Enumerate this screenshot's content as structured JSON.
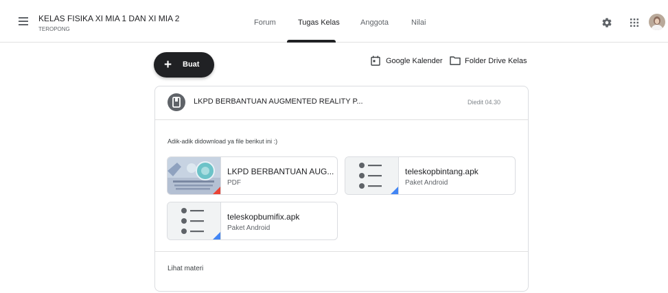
{
  "header": {
    "menu_icon": "hamburger-menu-icon",
    "class_title": "KELAS FISIKA XI MIA 1 DAN XI MIA 2",
    "class_subtitle": "TEROPONG",
    "tabs": [
      {
        "label": "Forum",
        "active": false
      },
      {
        "label": "Tugas Kelas",
        "active": true
      },
      {
        "label": "Anggota",
        "active": false
      },
      {
        "label": "Nilai",
        "active": false
      }
    ],
    "settings_icon": "gear-icon",
    "apps_icon": "apps-grid-icon",
    "avatar_icon": "user-avatar"
  },
  "toolbar": {
    "create_label": "Buat",
    "calendar_label": "Google Kalender",
    "drive_label": "Folder Drive Kelas"
  },
  "assignment": {
    "title": "LKPD BERBANTUAN AUGMENTED REALITY P...",
    "edited": "Diedit 04.30",
    "description": "Adik-adik didownload ya file berikut ini :)",
    "attachments": [
      {
        "name": "LKPD BERBANTUAN AUG...",
        "type": "PDF",
        "icon": "pdf-thumbnail"
      },
      {
        "name": "teleskopbintang.apk",
        "type": "Paket Android",
        "icon": "android-package-icon"
      },
      {
        "name": "teleskopbumifix.apk",
        "type": "Paket Android",
        "icon": "android-package-icon"
      }
    ],
    "view_material": "Lihat materi"
  },
  "colors": {
    "accent": "#202124",
    "border": "#dadce0",
    "text_secondary": "#5f6368",
    "pdf_red": "#ea4335",
    "drive_blue": "#4285f4"
  }
}
